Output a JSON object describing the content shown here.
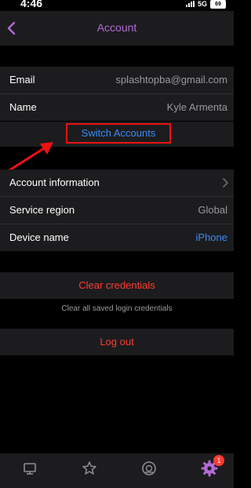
{
  "status": {
    "time": "4:46",
    "network": "5G",
    "battery": "69"
  },
  "nav": {
    "title": "Account"
  },
  "account": {
    "email_label": "Email",
    "email_value": "splashtopba@gmail.com",
    "name_label": "Name",
    "name_value": "Kyle Armenta",
    "switch_label": "Switch Accounts"
  },
  "settings": {
    "info_label": "Account information",
    "region_label": "Service region",
    "region_value": "Global",
    "device_label": "Device name",
    "device_value": "iPhone"
  },
  "actions": {
    "clear_label": "Clear credentials",
    "clear_caption": "Clear all saved login credentials",
    "logout_label": "Log out"
  },
  "tabbar": {
    "settings_badge": "1"
  },
  "colors": {
    "accent": "#b36ad6",
    "link": "#3b8cf5",
    "destructive": "#ff3b30",
    "highlight": "#e11111"
  }
}
